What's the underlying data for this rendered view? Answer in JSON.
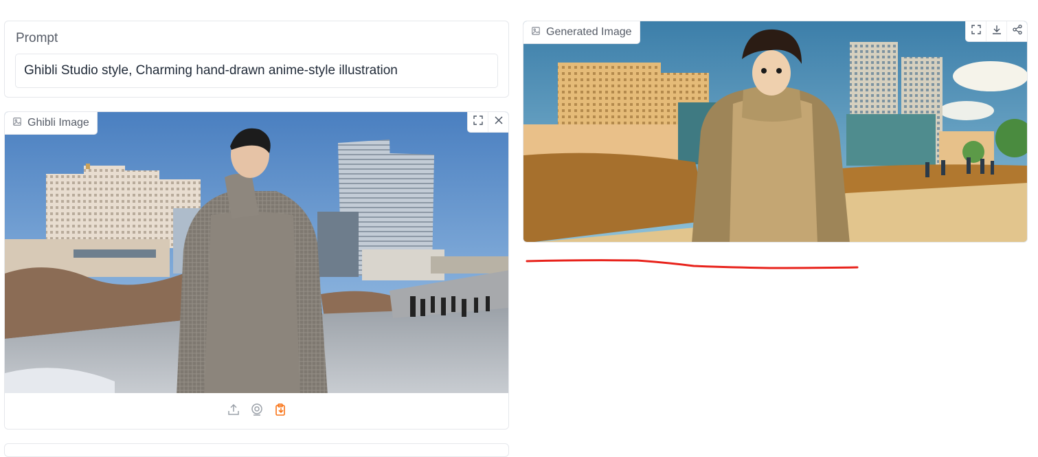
{
  "prompt": {
    "label": "Prompt",
    "value": "Ghibli Studio style, Charming hand-drawn anime-style illustration"
  },
  "input_image": {
    "label": "Ghibli Image",
    "label_icon": "image-icon",
    "tools": [
      "fullscreen-icon",
      "close-icon"
    ],
    "footer_tools": [
      "upload-icon",
      "webcam-icon",
      "clipboard-icon"
    ],
    "active_footer_tool": "clipboard-icon"
  },
  "output_image": {
    "label": "Generated Image",
    "label_icon": "image-icon",
    "tools": [
      "fullscreen-icon",
      "download-icon",
      "share-icon"
    ]
  },
  "colors": {
    "accent": "#f97316",
    "border": "#e5e7eb",
    "annotation": "#e8221b"
  }
}
